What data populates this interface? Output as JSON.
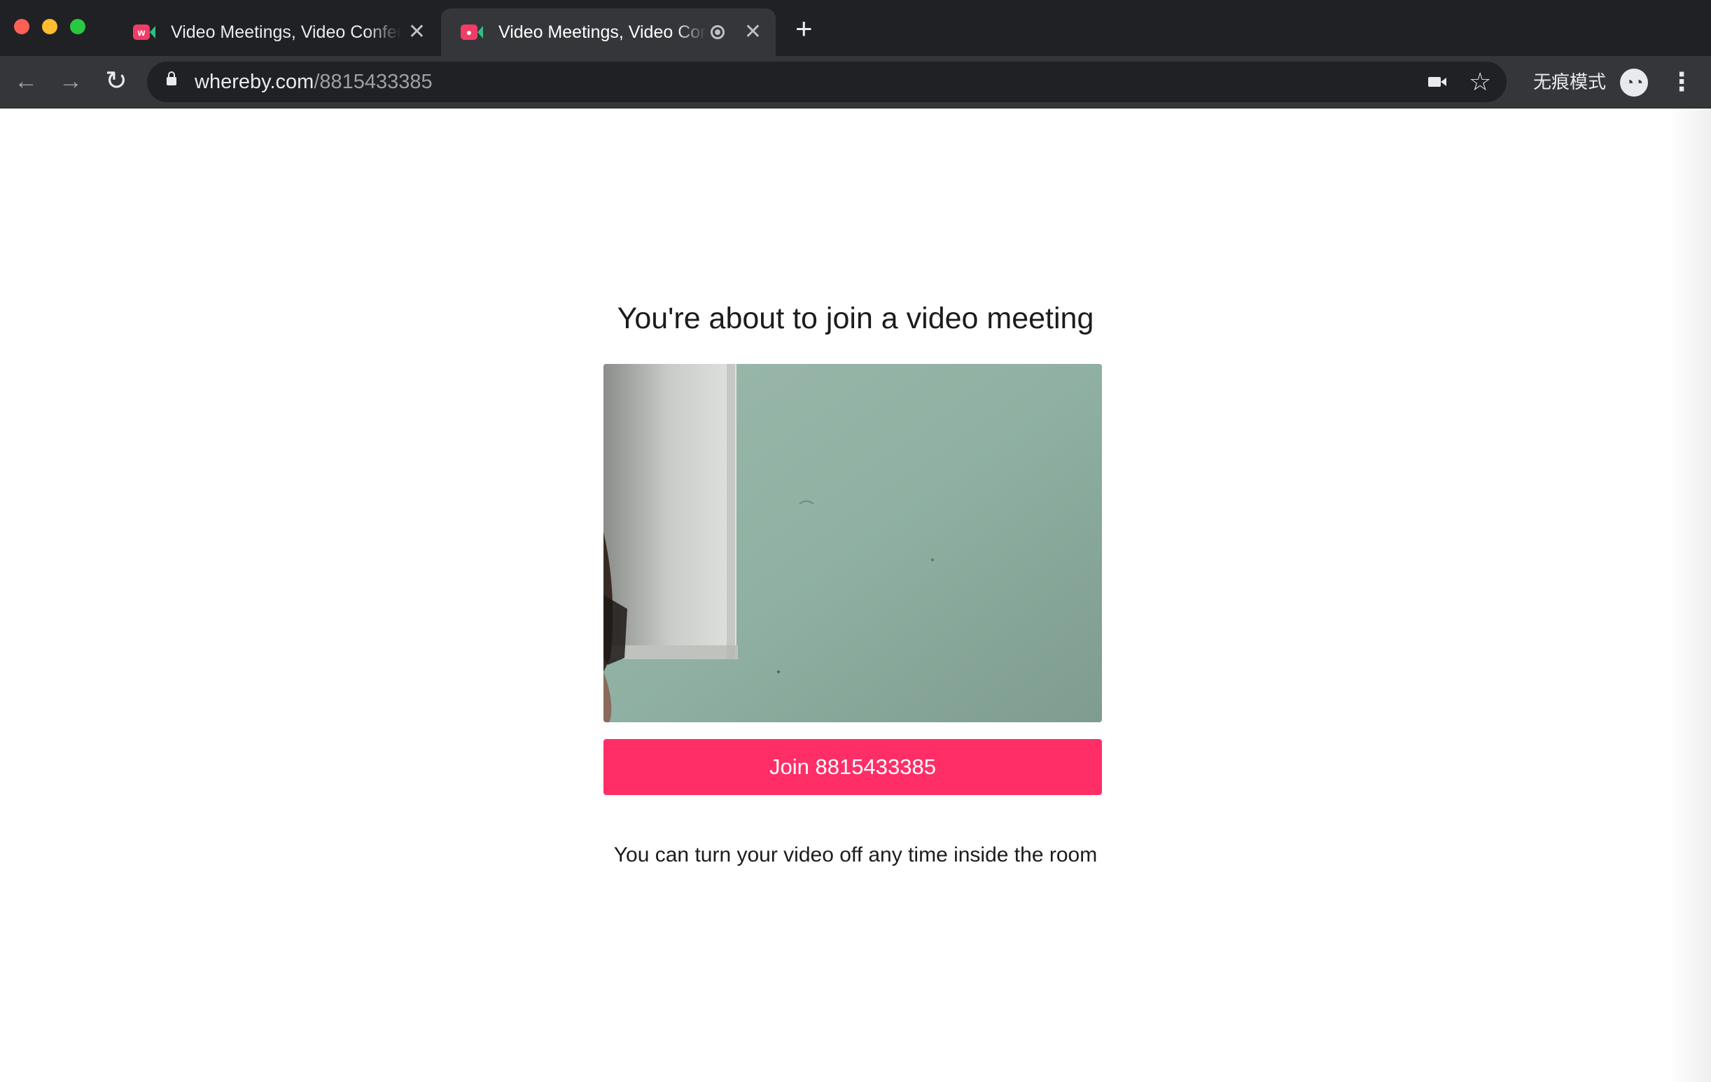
{
  "browser": {
    "tabs": [
      {
        "title": "Video Meetings, Video Conferencing",
        "favicon": "whereby-icon",
        "active": false
      },
      {
        "title": "Video Meetings, Video Conferencing",
        "favicon": "whereby-icon",
        "active": true,
        "recording_indicator": true
      }
    ],
    "new_tab_glyph": "+",
    "tab_close_glyph": "✕",
    "address_bar": {
      "host": "whereby.com",
      "path": "/8815433385"
    },
    "incognito_label": "无痕模式",
    "icons": [
      "back-arrow-icon",
      "forward-arrow-icon",
      "reload-icon",
      "lock-icon",
      "camera-icon",
      "star-icon",
      "incognito-icon",
      "more-menu-icon"
    ]
  },
  "page": {
    "title": "You're about to join a video meeting",
    "join_button_label": "Join 8815433385",
    "hint": "You can turn your video off any time inside the room"
  },
  "colors": {
    "chrome_dark": "#202124",
    "chrome_toolbar": "#35363a",
    "brand_accent": "#ff2e67",
    "text": "#1c1c1c"
  }
}
